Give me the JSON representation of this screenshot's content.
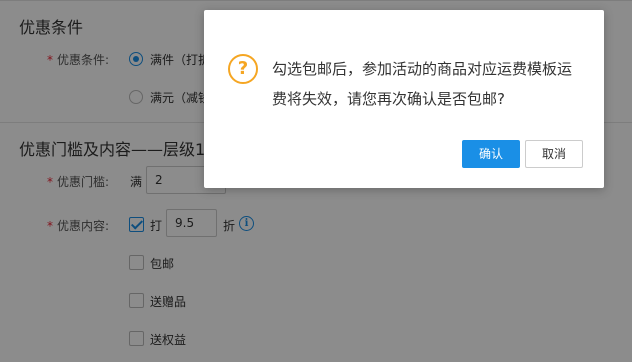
{
  "form": {
    "section1_title": "优惠条件",
    "condition_label": "优惠条件:",
    "condition_options": [
      "满件（打折）",
      "满元（减钱）"
    ],
    "section2_title": "优惠门槛及内容——层级1",
    "threshold_label": "优惠门槛:",
    "threshold_prefix": "满",
    "threshold_value": "2",
    "content_label": "优惠内容:",
    "discount_prefix": "打",
    "discount_value": "9.5",
    "discount_suffix": "折",
    "info_icon_glyph": "i",
    "free_shipping_label": "包邮",
    "gift_label": "送赠品",
    "rights_label": "送权益",
    "required_mark": "*"
  },
  "dialog": {
    "icon": "question-icon",
    "icon_glyph": "?",
    "message": "勾选包邮后，参加活动的商品对应运费模板运费将失效，请您再次确认是否包邮?",
    "confirm_label": "确认",
    "cancel_label": "取消"
  },
  "colors": {
    "accent": "#1a8fe6",
    "warning": "#f5a623",
    "required": "#e23333"
  }
}
